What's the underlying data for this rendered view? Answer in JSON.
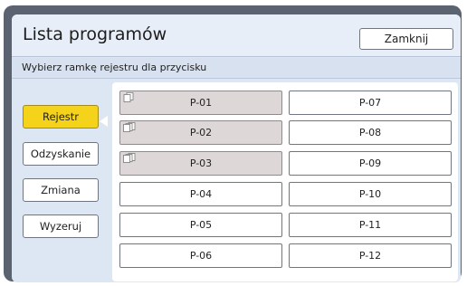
{
  "header": {
    "title": "Lista programów",
    "close_label": "Zamknij"
  },
  "subtitle": "Wybierz ramkę rejestru dla przycisku",
  "left_buttons": [
    {
      "label": "Rejestr",
      "active": true
    },
    {
      "label": "Odzyskanie",
      "active": false
    },
    {
      "label": "Zmiana",
      "active": false
    },
    {
      "label": "Wyzeruj",
      "active": false
    }
  ],
  "slots": {
    "left": [
      {
        "label": "P-01",
        "filled": true
      },
      {
        "label": "P-02",
        "filled": true
      },
      {
        "label": "P-03",
        "filled": true
      },
      {
        "label": "P-04",
        "filled": false
      },
      {
        "label": "P-05",
        "filled": false
      },
      {
        "label": "P-06",
        "filled": false
      }
    ],
    "right": [
      {
        "label": "P-07",
        "filled": false
      },
      {
        "label": "P-08",
        "filled": false
      },
      {
        "label": "P-09",
        "filled": false
      },
      {
        "label": "P-10",
        "filled": false
      },
      {
        "label": "P-11",
        "filled": false
      },
      {
        "label": "P-12",
        "filled": false
      }
    ]
  },
  "colors": {
    "accent_active": "#f4d31a",
    "filled_slot": "#ddd8d7",
    "panel_bg": "#dde6f3",
    "frame": "#5b6270"
  },
  "icons": {
    "stored_program": "document-stack-icon",
    "selection_pointer": "pointer-arrow-icon"
  }
}
